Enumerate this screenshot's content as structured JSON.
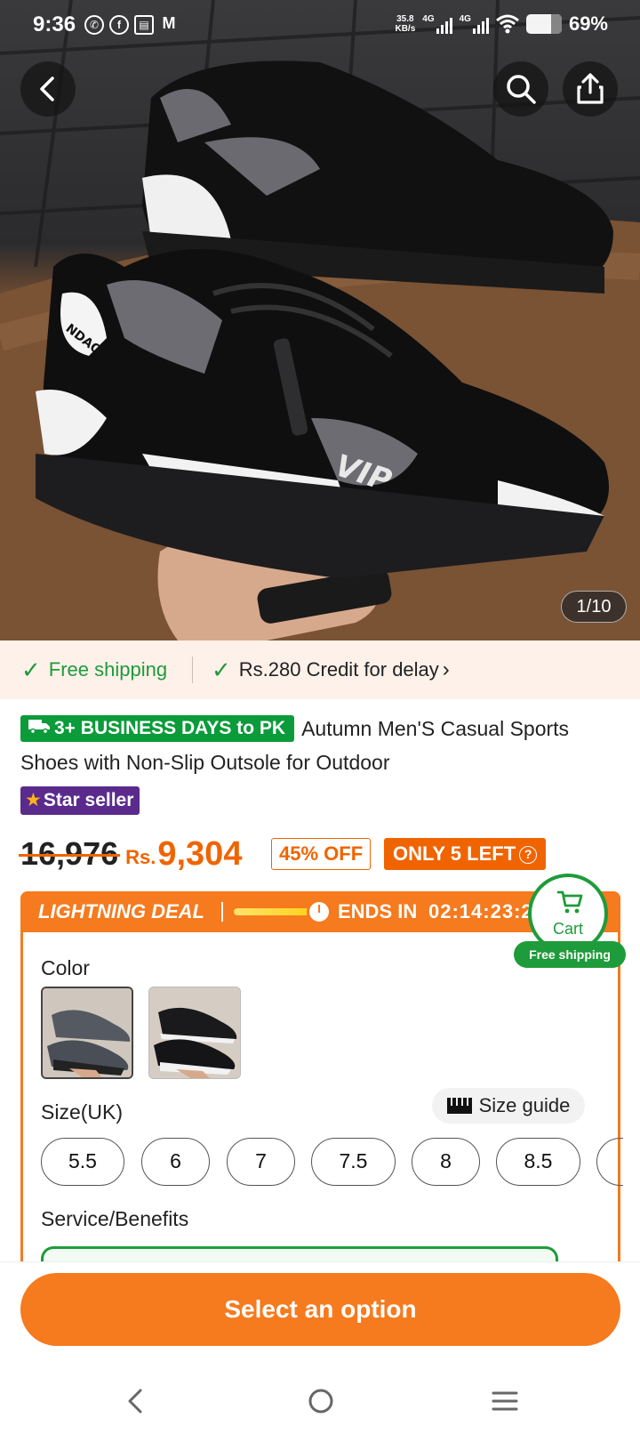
{
  "status_bar": {
    "time": "9:36",
    "net_speed_value": "35.8",
    "net_speed_unit": "KB/s",
    "signal_1": "4G",
    "signal_2": "4G",
    "battery": "69%"
  },
  "product_image": {
    "counter": "1/10",
    "logo_text": "NDAO",
    "side_text": "VIP"
  },
  "shipping_strip": {
    "free_shipping": "Free shipping",
    "credit": "Rs.280 Credit for delay",
    "credit_chevron": "›"
  },
  "product": {
    "delivery_badge": "3+ BUSINESS DAYS to PK",
    "title": "Autumn Men'S Casual Sports Shoes with Non-Slip Outsole for Outdoor",
    "seller_badge": "Star seller"
  },
  "price": {
    "original": "16,976",
    "currency": "Rs.",
    "current": "9,304",
    "discount": "45% OFF",
    "stock": "ONLY 5 LEFT",
    "stock_help": "?"
  },
  "deal": {
    "title": "LIGHTNING DEAL",
    "ends_label": "ENDS IN",
    "timer": "02:14:23:27",
    "progress": 0.85
  },
  "options": {
    "color_label": "Color",
    "size_label": "Size(UK)",
    "size_guide": "Size guide",
    "sizes": [
      "5.5",
      "6",
      "7",
      "7.5",
      "8",
      "8.5",
      ""
    ],
    "benefits_label": "Service/Benefits"
  },
  "cart": {
    "label": "Cart",
    "shipping": "Free shipping"
  },
  "cta": {
    "label": "Select an option"
  },
  "colors": {
    "accent": "#f67a1e",
    "price": "#f06400",
    "green": "#1e9b3a",
    "star_seller": "#5a2b8c"
  }
}
